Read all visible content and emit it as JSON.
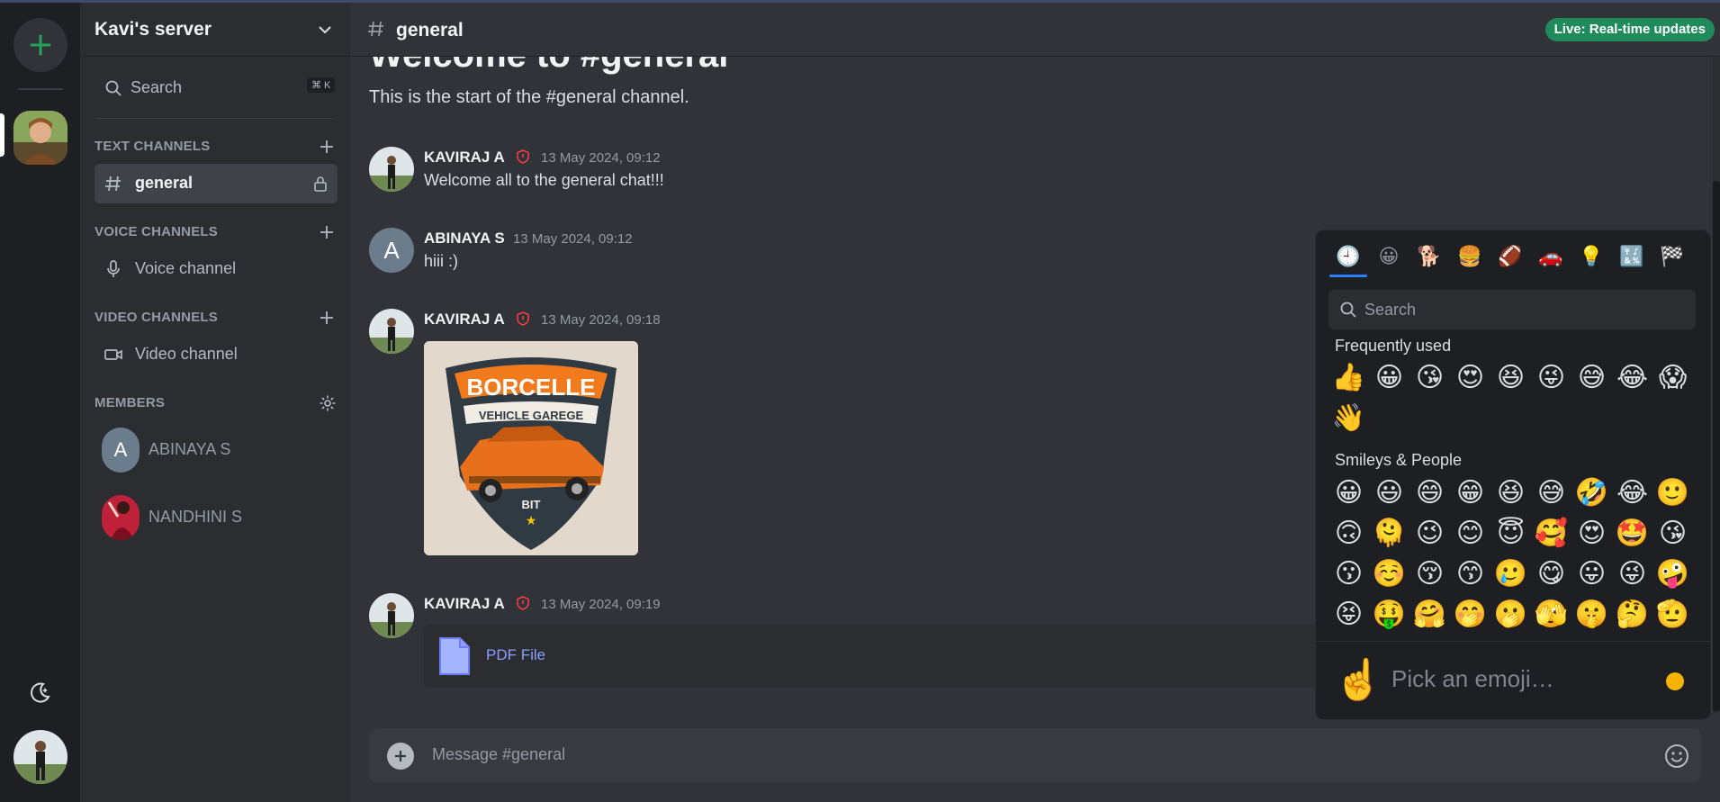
{
  "server": {
    "name": "Kavi's server",
    "search_label": "Search",
    "search_shortcut": "⌘ K"
  },
  "sidebar": {
    "text_channels_title": "TEXT CHANNELS",
    "voice_channels_title": "VOICE CHANNELS",
    "video_channels_title": "VIDEO CHANNELS",
    "members_title": "MEMBERS",
    "text_channels": [
      {
        "label": "general",
        "active": true,
        "locked": true
      }
    ],
    "voice_channels": [
      {
        "label": "Voice channel"
      }
    ],
    "video_channels": [
      {
        "label": "Video channel"
      }
    ],
    "members": [
      {
        "name": "ABINAYA S",
        "initial": "A"
      },
      {
        "name": "NANDHINI S"
      }
    ]
  },
  "channel": {
    "name": "general",
    "live_badge": "Live: Real-time updates",
    "welcome_title": "Welcome to #general",
    "welcome_subtitle": "This is the start of the #general channel."
  },
  "messages": [
    {
      "author": "KAVIRAJ A",
      "moderator": true,
      "time": "13 May 2024, 09:12",
      "text": "Welcome all to the general chat!!!"
    },
    {
      "author": "ABINAYA S",
      "initial": "A",
      "moderator": false,
      "time": "13 May 2024, 09:12",
      "text": "hiii :)"
    },
    {
      "author": "KAVIRAJ A",
      "moderator": true,
      "time": "13 May 2024, 09:18",
      "attachment": {
        "type": "image",
        "logo_title": "BORCELLE",
        "logo_subtitle": "VEHICLE GAREGE",
        "logo_tag": "BIT"
      }
    },
    {
      "author": "KAVIRAJ A",
      "moderator": true,
      "time": "13 May 2024, 09:19",
      "attachment": {
        "type": "file",
        "label": "PDF File"
      }
    }
  ],
  "composer": {
    "placeholder": "Message #general"
  },
  "emoji_picker": {
    "search_placeholder": "Search",
    "categories": [
      "🕘",
      "😀",
      "🐕",
      "🍔",
      "🏈",
      "🚗",
      "💡",
      "🔣",
      "🏁"
    ],
    "frequently_used_title": "Frequently used",
    "frequently_used": [
      "👍",
      "😀",
      "😘",
      "😍",
      "😆",
      "😜",
      "😅",
      "😂",
      "😱",
      "👋"
    ],
    "smileys_title": "Smileys & People",
    "smileys": [
      "😀",
      "😃",
      "😄",
      "😁",
      "😆",
      "😅",
      "🤣",
      "😂",
      "🙂",
      "🙃",
      "🫠",
      "😉",
      "😊",
      "😇",
      "🥰",
      "😍",
      "🤩",
      "😘",
      "😗",
      "☺️",
      "😚",
      "😙",
      "🥲",
      "😋",
      "😛",
      "😜",
      "🤪",
      "😝",
      "🤑",
      "🤗",
      "🤭",
      "🫢",
      "🫣",
      "🤫",
      "🤔",
      "🫡"
    ],
    "preview_emoji": "☝️",
    "preview_text": "Pick an emoji…",
    "skin_tone_color": "#f5b400"
  },
  "colors": {
    "accent": "#2a7fff",
    "live": "#1f8b5a",
    "moderator": "#f23f43",
    "link": "#8b9eff"
  }
}
